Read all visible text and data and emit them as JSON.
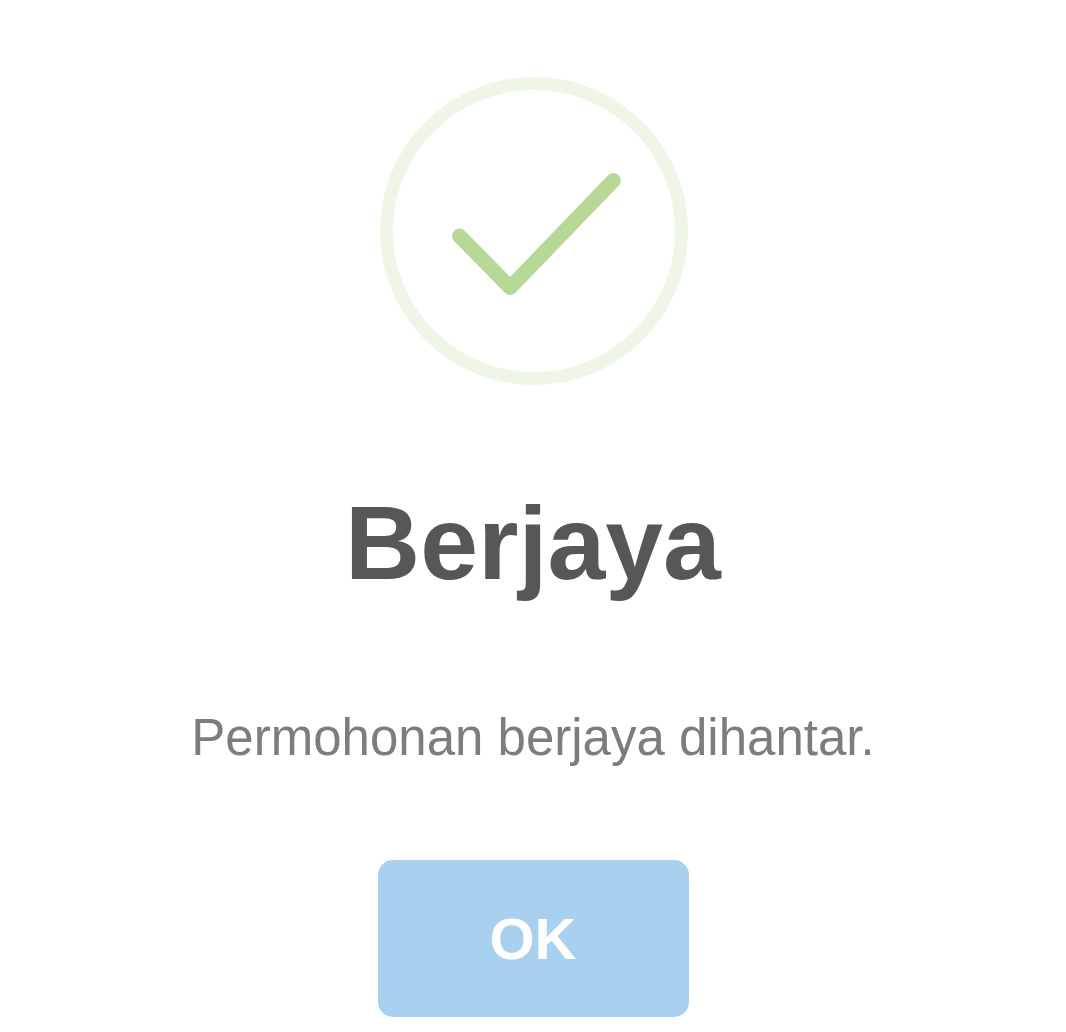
{
  "title": "Berjaya",
  "message": "Permohonan berjaya dihantar.",
  "buttons": [
    {
      "label": "OK"
    }
  ]
}
